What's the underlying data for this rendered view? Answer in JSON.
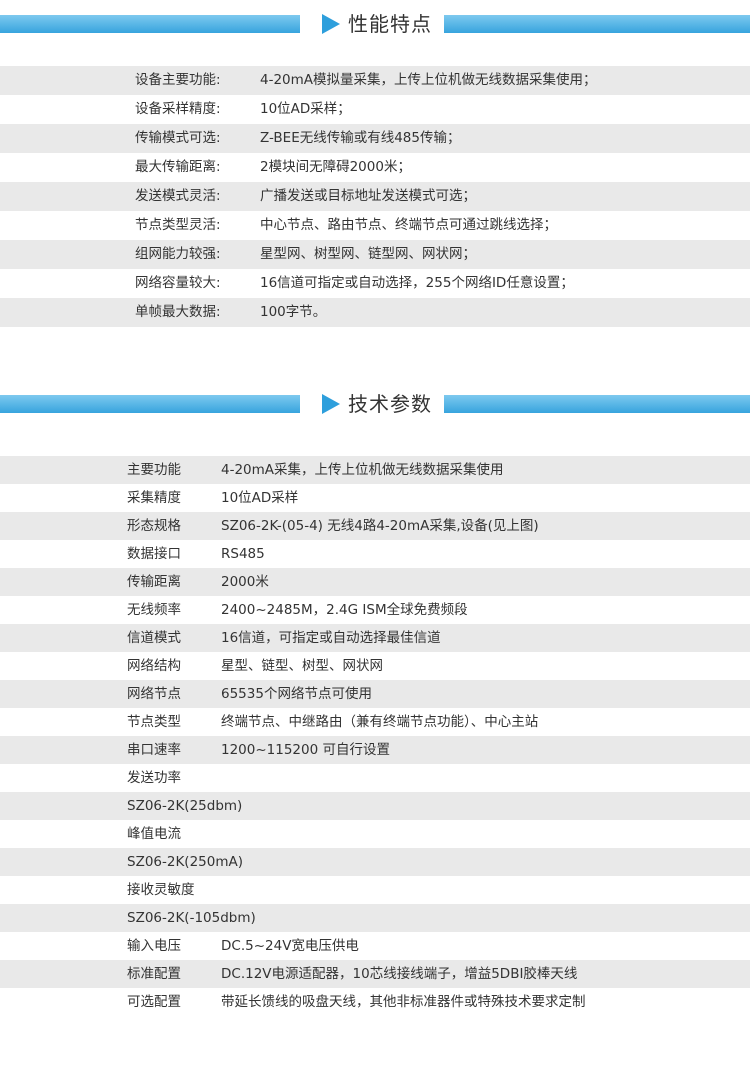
{
  "features": {
    "title": "性能特点",
    "rows": [
      {
        "label": "设备主要功能:",
        "value": "4-20mA模拟量采集，上传上位机做无线数据采集使用；"
      },
      {
        "label": "设备采样精度:",
        "value": "10位AD采样；"
      },
      {
        "label": "传输模式可选:",
        "value": "Z-BEE无线传输或有线485传输；"
      },
      {
        "label": "最大传输距离:",
        "value": "2模块间无障碍2000米；"
      },
      {
        "label": "发送模式灵活:",
        "value": "广播发送或目标地址发送模式可选；"
      },
      {
        "label": "节点类型灵活:",
        "value": "中心节点、路由节点、终端节点可通过跳线选择；"
      },
      {
        "label": "组网能力较强:",
        "value": "星型网、树型网、链型网、网状网；"
      },
      {
        "label": "网络容量较大:",
        "value": "16信道可指定或自动选择，255个网络ID任意设置；"
      },
      {
        "label": "单帧最大数据:",
        "value": "100字节。"
      }
    ]
  },
  "params": {
    "title": "技术参数",
    "rows": [
      {
        "label": "主要功能",
        "value": "4-20mA采集，上传上位机做无线数据采集使用"
      },
      {
        "label": "采集精度",
        "value": "10位AD采样"
      },
      {
        "label": "形态规格",
        "value": "SZ06-2K-(05-4) 无线4路4-20mA采集,设备(见上图)"
      },
      {
        "label": "数据接口",
        "value": "RS485"
      },
      {
        "label": "传输距离",
        "value": "2000米"
      },
      {
        "label": "无线频率",
        "value": "2400~2485M，2.4G ISM全球免费频段"
      },
      {
        "label": "信道模式",
        "value": "16信道，可指定或自动选择最佳信道"
      },
      {
        "label": "网络结构",
        "value": "星型、链型、树型、网状网"
      },
      {
        "label": "网络节点",
        "value": "65535个网络节点可使用"
      },
      {
        "label": "节点类型",
        "value": "终端节点、中继路由（兼有终端节点功能）、中心主站"
      },
      {
        "label": "串口速率",
        "value": "1200~115200 可自行设置"
      },
      {
        "label": "发送功率",
        "value": ""
      },
      {
        "label": "SZ06-2K(25dbm)",
        "value": ""
      },
      {
        "label": "峰值电流",
        "value": ""
      },
      {
        "label": "SZ06-2K(250mA)",
        "value": ""
      },
      {
        "label": "接收灵敏度",
        "value": ""
      },
      {
        "label": "SZ06-2K(-105dbm)",
        "value": ""
      },
      {
        "label": "输入电压",
        "value": "DC.5~24V宽电压供电"
      },
      {
        "label": "标准配置",
        "value": "DC.12V电源适配器，10芯线接线端子，增益5DBI胶棒天线"
      },
      {
        "label": "可选配置",
        "value": "带延长馈线的吸盘天线，其他非标准器件或特殊技术要求定制"
      }
    ]
  },
  "colors": {
    "banner": "#37a4de",
    "arrow": "#2e9fdc",
    "row_shade": "#e9e9e9"
  }
}
